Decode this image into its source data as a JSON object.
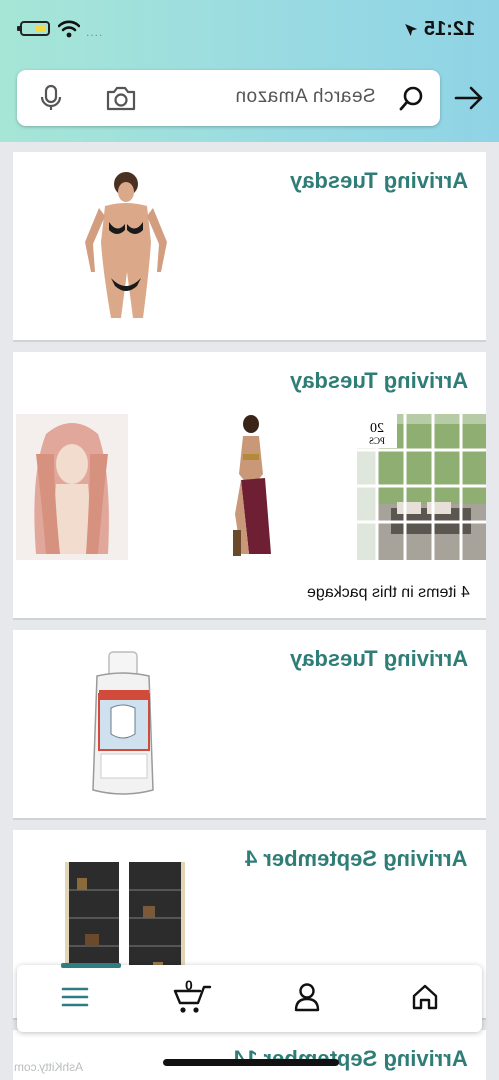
{
  "status_bar": {
    "time": "12:15",
    "signal": "....",
    "icons": [
      "battery-icon",
      "wifi-icon",
      "location-arrow-icon"
    ]
  },
  "search": {
    "placeholder": "Search Amazon",
    "icons": [
      "microphone-icon",
      "camera-icon",
      "search-icon",
      "arrow-right-icon"
    ]
  },
  "orders": [
    {
      "title": "Arriving Tuesday",
      "images": [
        "bikini-swimsuit-photo"
      ]
    },
    {
      "title": "Arriving Tuesday",
      "images": [
        "pink-wig-photo",
        "costume-photo",
        "window-decals-photo"
      ],
      "note": "4 items in this package"
    },
    {
      "title": "Arriving Tuesday",
      "images": [
        "dry-hands-bottle-photo"
      ]
    },
    {
      "title": "Arriving September 4",
      "images": [
        "bookshelf-photo"
      ]
    },
    {
      "title": "Arriving September 14",
      "images": []
    }
  ],
  "bottom_nav": {
    "items": [
      "menu",
      "cart",
      "account",
      "home"
    ],
    "cart_count": "0"
  },
  "watermark": "AshKitty.com",
  "colors": {
    "accent": "#2f7d77",
    "header_start": "#a6e6d6",
    "header_end": "#8fd3e5"
  }
}
